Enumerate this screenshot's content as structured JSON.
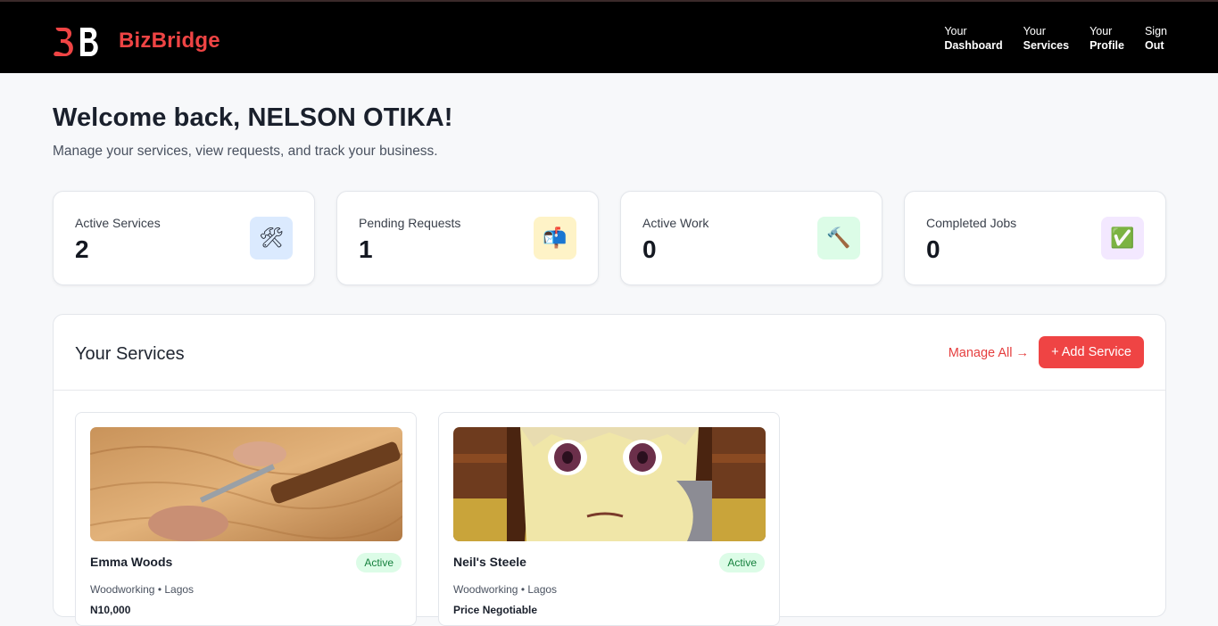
{
  "header": {
    "brand": "BizBridge",
    "nav": [
      {
        "line1": "Your",
        "line2": "Dashboard"
      },
      {
        "line1": "Your",
        "line2": "Services"
      },
      {
        "line1": "Your",
        "line2": "Profile"
      },
      {
        "line1": "Sign",
        "line2": "Out"
      }
    ]
  },
  "welcome": {
    "title": "Welcome back, NELSON OTIKA!",
    "subtitle": "Manage your services, view requests, and track your business."
  },
  "stats": [
    {
      "label": "Active Services",
      "value": "2",
      "icon": "tools-icon",
      "icon_glyph": "🛠",
      "icon_bg": "#dbeafe"
    },
    {
      "label": "Pending Requests",
      "value": "1",
      "icon": "mailbox-icon",
      "icon_glyph": "📬",
      "icon_bg": "#fef3c7"
    },
    {
      "label": "Active Work",
      "value": "0",
      "icon": "hammer-icon",
      "icon_glyph": "🔨",
      "icon_bg": "#dcfce7"
    },
    {
      "label": "Completed Jobs",
      "value": "0",
      "icon": "check-icon",
      "icon_glyph": "✅",
      "icon_bg": "#f3e8ff"
    }
  ],
  "services": {
    "title": "Your Services",
    "manage_label": "Manage All →",
    "add_label": "+ Add Service",
    "items": [
      {
        "name": "Emma Woods",
        "status": "Active",
        "meta": "Woodworking • Lagos",
        "extra": "N10,000"
      },
      {
        "name": "Neil's Steele",
        "status": "Active",
        "meta": "Woodworking • Lagos",
        "extra": "Price Negotiable"
      }
    ]
  },
  "colors": {
    "accent": "#ef4444",
    "topbar": "#000000",
    "badge_bg": "#dcfce7",
    "badge_text": "#15803d"
  }
}
